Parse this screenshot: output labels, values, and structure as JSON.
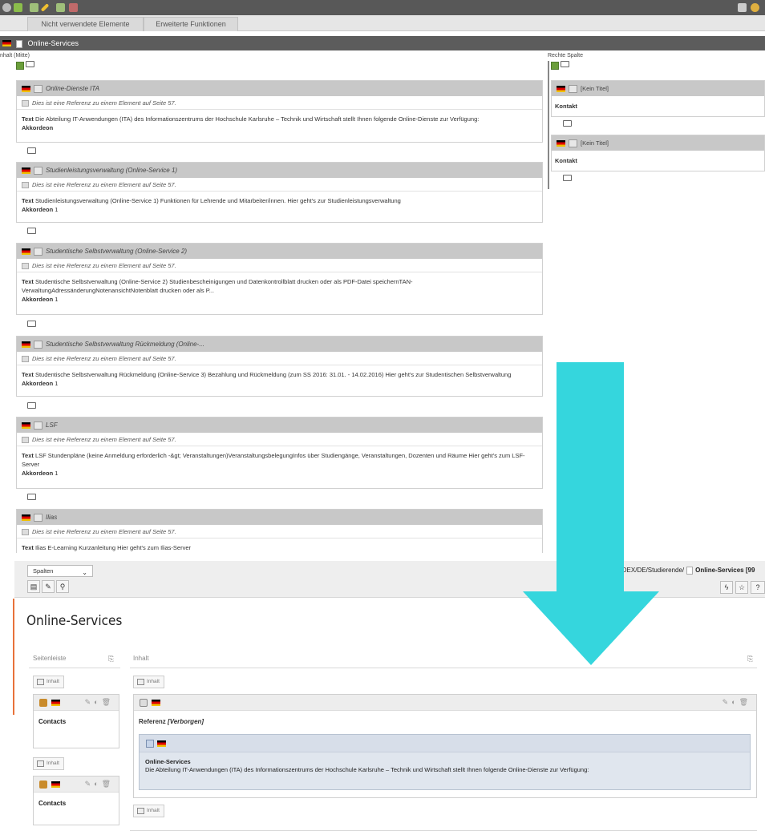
{
  "old_ui": {
    "tabs": [
      "Nicht verwendete Elemente",
      "Erweiterte Funktionen"
    ],
    "page_title": "Online-Services",
    "left_column_label": "nhalt (Mitte)",
    "right_column_label": "Rechte Spalte",
    "ref_text": "Dies ist eine Referenz zu einem Element auf Seite 57.",
    "blocks": [
      {
        "title": "Online-Dienste ITA",
        "body_text": "Die Abteilung IT-Anwendungen (ITA) des Informationszentrums der Hochschule Karlsruhe – Technik und Wirtschaft stellt Ihnen folgende Online-Dienste zur Verfügung:",
        "akkordeon": ""
      },
      {
        "title": "Studienleistungsverwaltung (Online-Service 1)",
        "body_text": "Studienleistungsverwaltung (Online-Service 1) Funktionen für Lehrende und Mitarbeiter/innen. Hier geht's zur Studienleistungsverwaltung",
        "akkordeon": "1"
      },
      {
        "title": "Studentische Selbstverwaltung (Online-Service 2)",
        "body_text": "Studentische Selbstverwaltung (Online-Service 2) Studienbescheinigungen und Datenkontrollblatt drucken oder als PDF-Datei speichernTAN-VerwaltungAdressänderungNotenansichtNotenblatt drucken oder als P...",
        "akkordeon": "1"
      },
      {
        "title": "Studentische Selbstverwaltung Rückmeldung (Online-...",
        "body_text": "Studentische Selbstverwaltung Rückmeldung (Online-Service 3) Bezahlung und Rückmeldung (zum SS 2016: 31.01. - 14.02.2016) Hier geht's zur Studentischen Selbstverwaltung",
        "akkordeon": "1"
      },
      {
        "title": "LSF",
        "body_text": "LSF Stundenpläne (keine Anmeldung erforderlich -&gt; Veranstaltungen)VeranstaltungsbelegungInfos über Studiengänge, Veranstaltungen, Dozenten und Räume Hier geht's zum LSF-Server",
        "akkordeon": "1"
      },
      {
        "title": "Ilias",
        "body_text": "Ilias E-Learning Kurzanleitung Hier geht's zum Ilias-Server",
        "akkordeon": ""
      }
    ],
    "text_label": "Text",
    "akkordeon_label": "Akkordeon",
    "right_blocks": [
      {
        "title": "[Kein Titel]",
        "body": "Kontakt"
      },
      {
        "title": "[Kein Titel]",
        "body": "Kontakt"
      }
    ]
  },
  "new_ui": {
    "select_value": "Spalten",
    "breadcrumb_path": "NDEX/DE/Studierende/",
    "breadcrumb_page": "Online-Services [99",
    "page_title": "Online-Services",
    "col_sidebar": "Seitenleiste",
    "col_content": "Inhalt",
    "add_label": "Inhalt",
    "sidebar_cards": [
      "Contacts",
      "Contacts"
    ],
    "ref_label": "Referenz",
    "ref_hidden": "[Verborgen]",
    "ref_title": "Online-Services",
    "ref_text": "Die Abteilung IT-Anwendungen (ITA) des Informationszentrums der Hochschule Karlsruhe – Technik und Wirtschaft stellt Ihnen folgende Online-Dienste zur Verfügung:"
  },
  "colors": {
    "arrow": "#35d6dd",
    "accent": "#e8723a"
  }
}
